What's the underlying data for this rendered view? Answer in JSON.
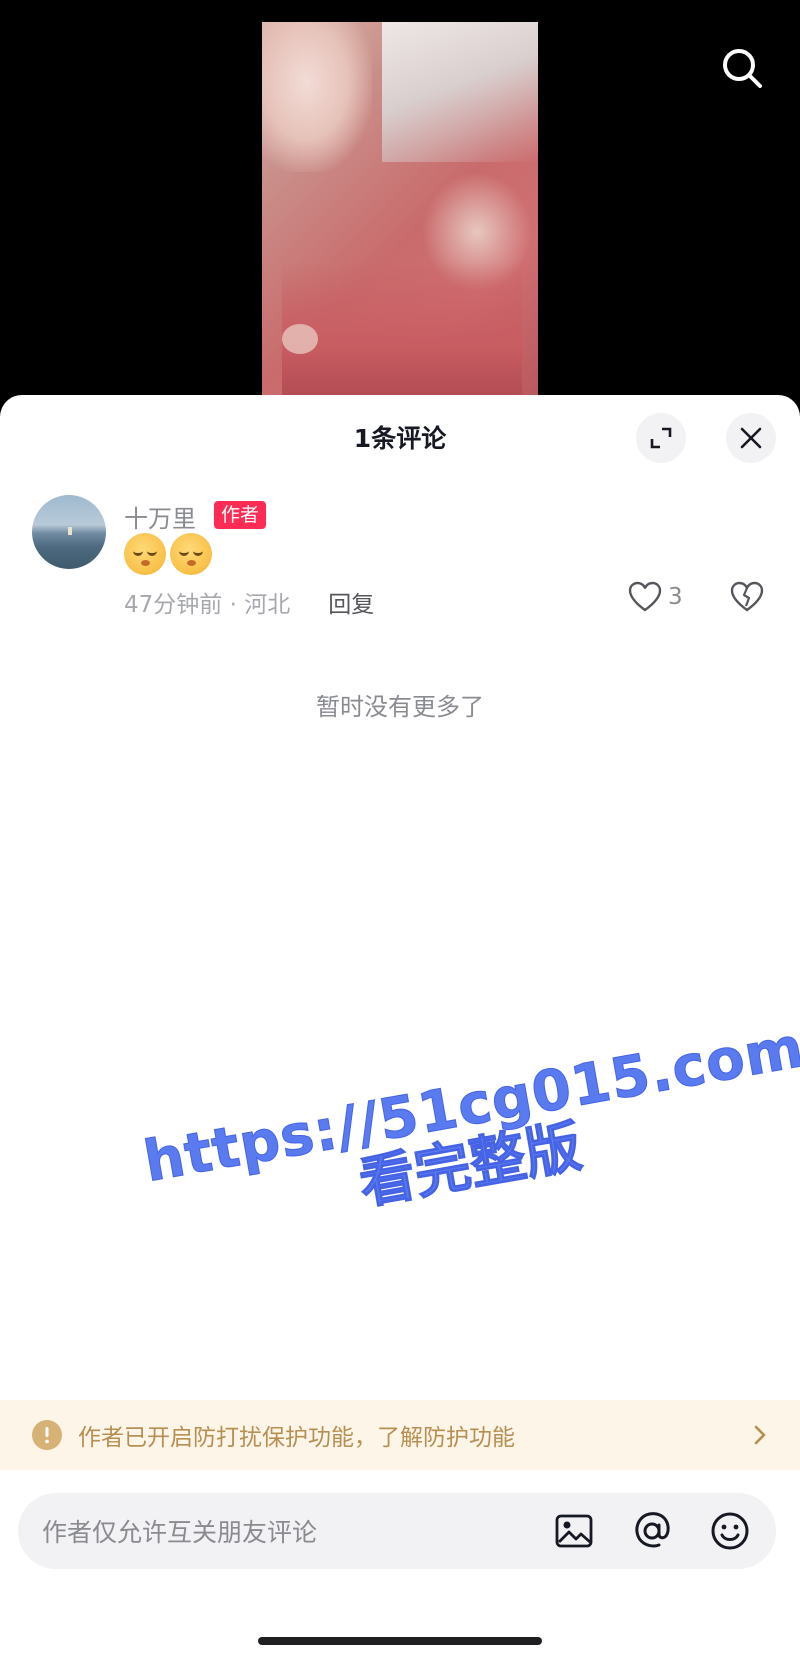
{
  "video": {
    "search_icon": "search-icon"
  },
  "sheet": {
    "title": "1条评论",
    "expand_icon": "expand-icon",
    "close_icon": "close-icon"
  },
  "comment": {
    "username": "十万里",
    "author_badge": "作者",
    "content_emojis": [
      "smirk-emoji",
      "smirk-emoji"
    ],
    "timestamp_location": "47分钟前 · 河北",
    "reply_label": "回复",
    "like_count": "3",
    "like_icon": "heart-icon",
    "dislike_icon": "broken-heart-icon"
  },
  "list_end": "暂时没有更多了",
  "watermark": {
    "url": "https://51cg015.com",
    "subtitle": "看完整版"
  },
  "notice": {
    "text": "作者已开启防打扰保护功能，了解防护功能",
    "icon": "warning-icon",
    "chevron": "chevron-right-icon"
  },
  "input": {
    "placeholder": "作者仅允许互关朋友评论",
    "icons": [
      "image-icon",
      "at-icon",
      "emoji-icon"
    ]
  },
  "colors": {
    "accent_red": "#fe2c55",
    "notice_bg": "#fdf6e8",
    "notice_text": "#b88f52",
    "watermark": "#5a7af0"
  }
}
